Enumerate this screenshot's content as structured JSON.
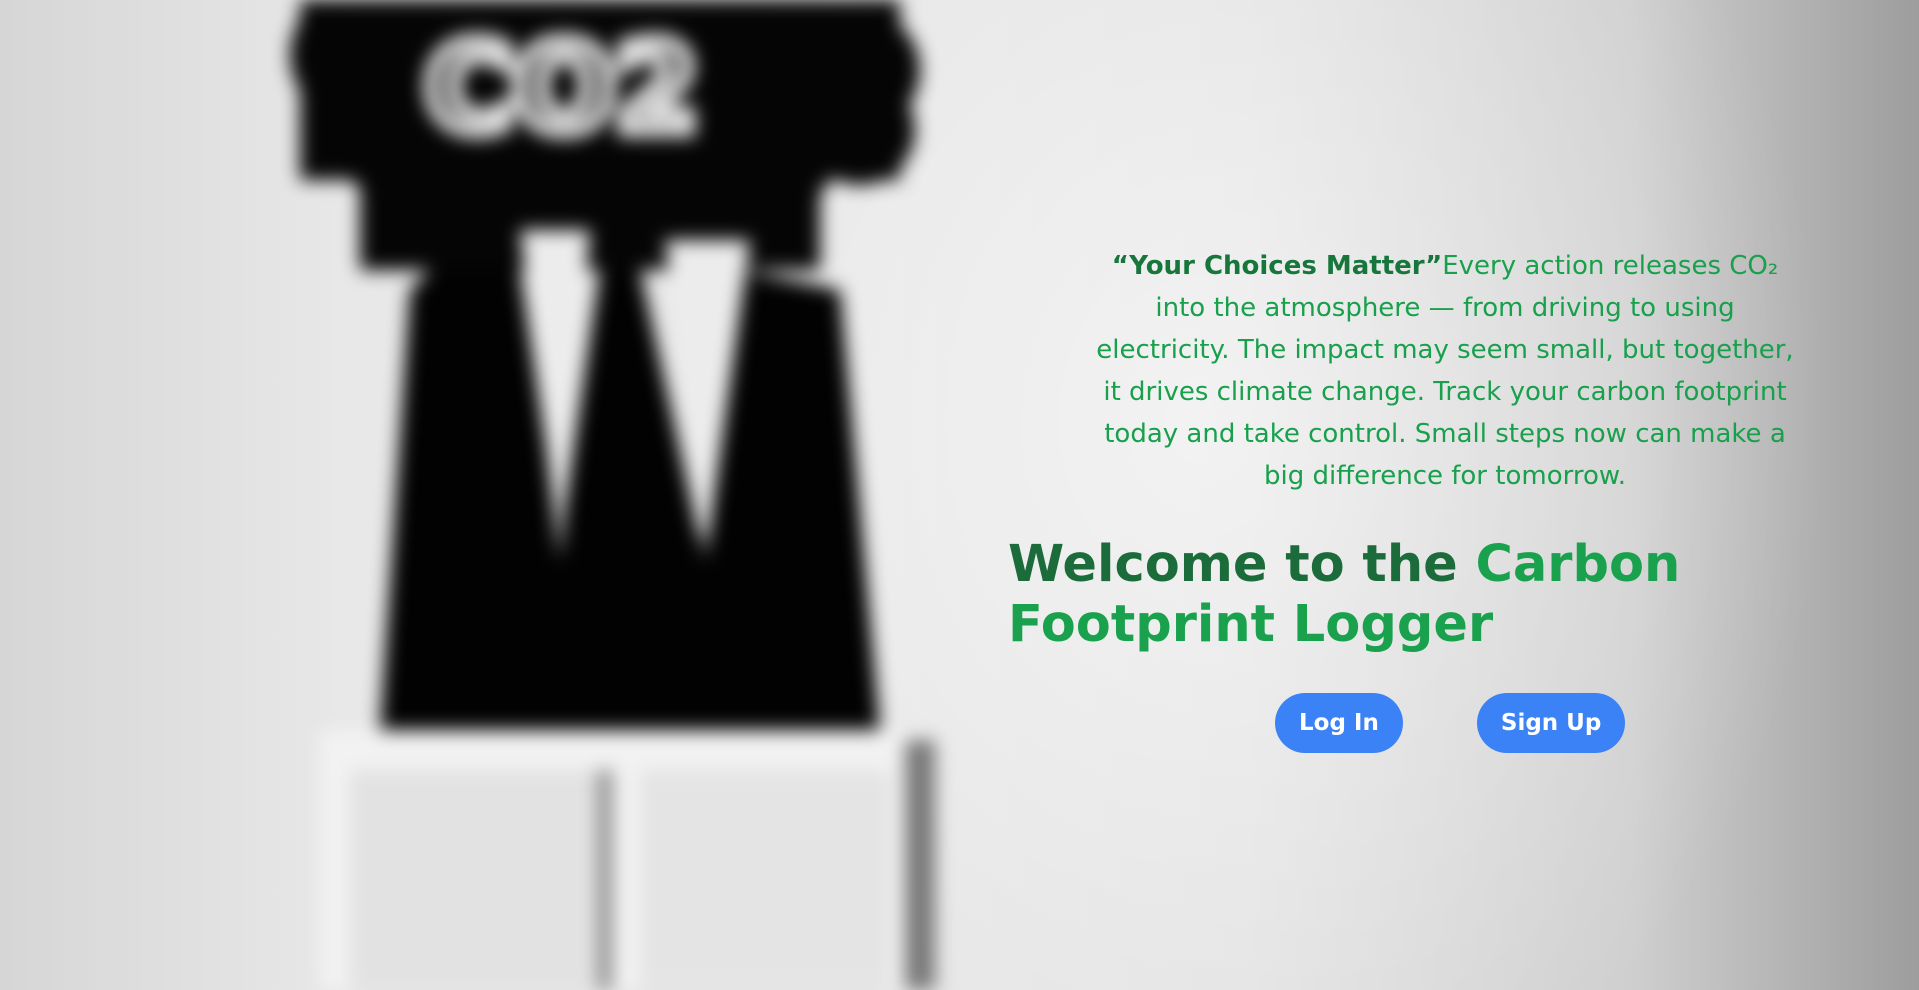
{
  "hero": {
    "quote_title": "“Your Choices Matter”",
    "quote_body": "Every action releases CO₂ into the atmosphere — from driving to using electricity. The impact may seem small, but together, it drives climate change. Track your carbon footprint today and take control. Small steps now can make a big difference for tomorrow.",
    "headline_prefix": "Welcome to the ",
    "headline_accent": "Carbon Footprint Logger"
  },
  "actions": {
    "login_label": "Log In",
    "signup_label": "Sign Up"
  },
  "background": {
    "sign_text": "CO2"
  },
  "colors": {
    "quote_text": "#18a04c",
    "quote_title": "#16763c",
    "headline_dark": "#1c6b3a",
    "headline_accent": "#1aa14e",
    "button": "#3b82f6"
  }
}
